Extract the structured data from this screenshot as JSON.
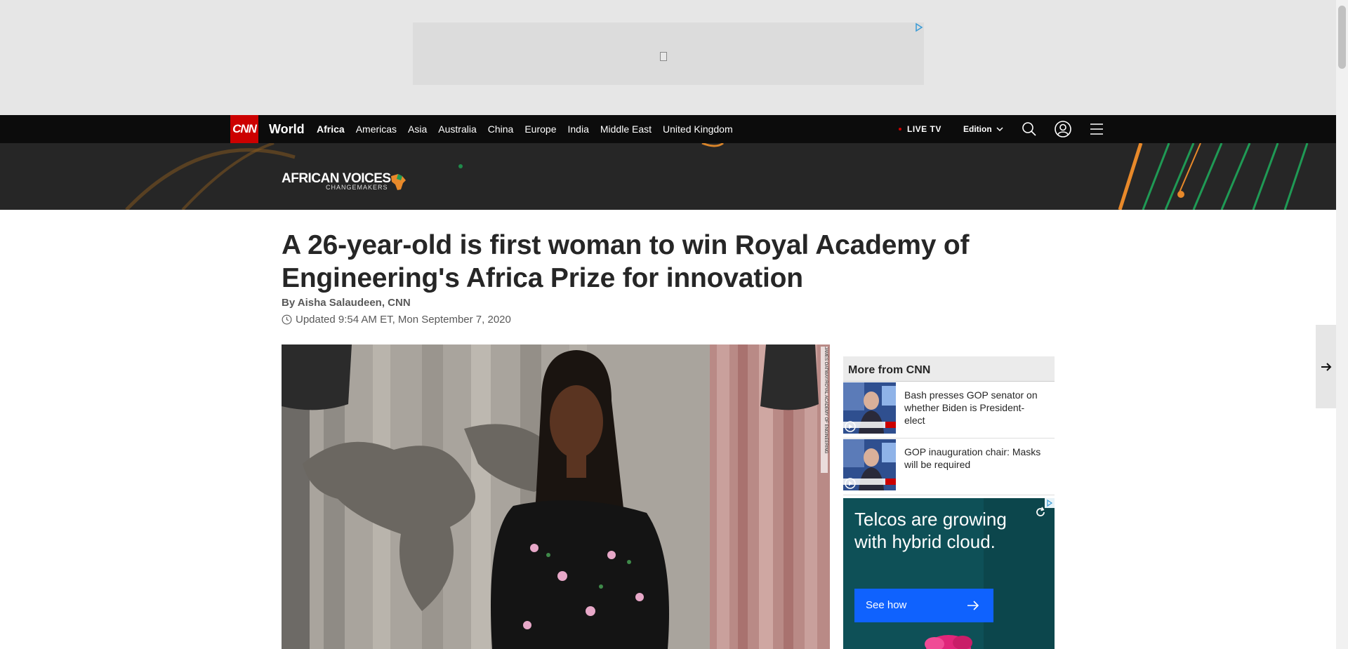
{
  "nav": {
    "logo": "CNN",
    "section": "World",
    "links": [
      "Africa",
      "Americas",
      "Asia",
      "Australia",
      "China",
      "Europe",
      "India",
      "Middle East",
      "United Kingdom"
    ],
    "live_tv": "LIVE TV",
    "edition": "Edition",
    "icons": [
      "search-icon",
      "account-icon",
      "menu-icon"
    ]
  },
  "banner": {
    "title": "AFRICAN VOICES",
    "subtitle": "CHANGEMAKERS"
  },
  "article": {
    "headline": "A 26-year-old is first woman to win Royal Academy of Engineering's Africa Prize for innovation",
    "byline": "By Aisha Salaudeen, CNN",
    "updated": "Updated 9:54 AM ET, Mon September 7, 2020",
    "photo_credit": "JAMES OATWAY/ROYAL ACADEMY OF ENGINEERING"
  },
  "more_from_cnn": {
    "title": "More from CNN",
    "items": [
      {
        "text": "Bash presses GOP senator on whether Biden is President-elect"
      },
      {
        "text": "GOP inauguration chair: Masks will be required"
      }
    ]
  },
  "ad": {
    "text": "Telcos are growing with hybrid cloud.",
    "cta": "See how"
  },
  "colors": {
    "brand_red": "#cc0000",
    "nav_bg": "#0c0c0c",
    "ad_teal": "#0e5057",
    "cta_blue": "#0f62fe"
  }
}
